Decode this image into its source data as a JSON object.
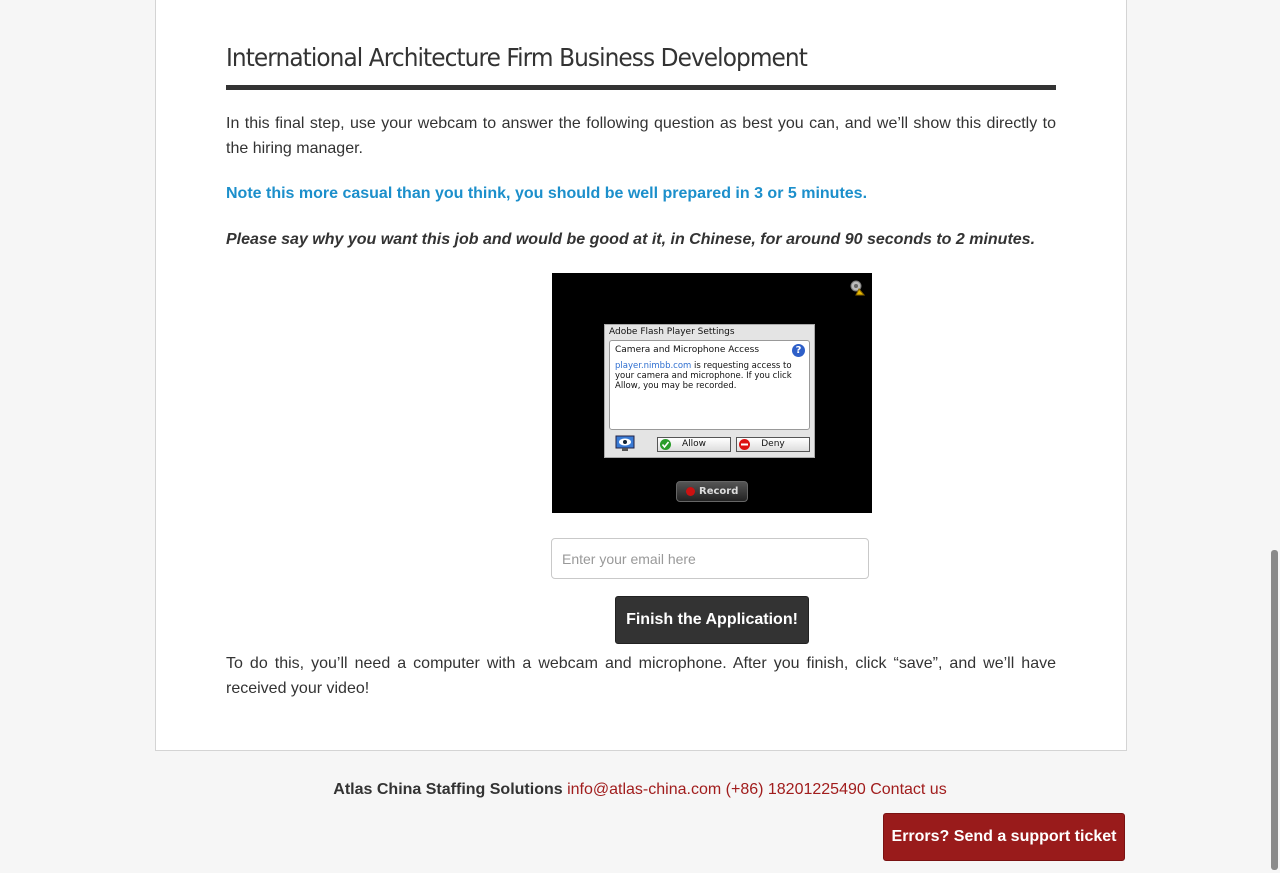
{
  "page": {
    "title": "International Architecture Firm Business Development",
    "intro": "In this final step, use your webcam to answer the following question as best you can, and we’ll show this directly to the hiring manager.",
    "note": "Note this more casual than you think, you should be well prepared in 3 or 5 minutes.",
    "question": "Please say why you want this job and would be good at it, in Chinese, for around 90 seconds to 2 minutes.",
    "outro": "To do this, you’ll need a computer with a webcam and microphone. After you finish, click “save”, and we’ll have received your video!"
  },
  "recorder": {
    "flash_dialog": {
      "title": "Adobe Flash Player Settings",
      "heading": "Camera and Microphone Access",
      "link_text": "player.nimbb.com",
      "body_text": " is requesting access to your camera and microphone. If you click Allow, you may be recorded.",
      "allow_label": "Allow",
      "deny_label": "Deny",
      "help_symbol": "?"
    },
    "record_label": "Record",
    "icons": [
      "settings-icon",
      "help-icon",
      "monitor-icon",
      "check-icon",
      "deny-icon",
      "record-dot-icon"
    ]
  },
  "form": {
    "email_placeholder": "Enter your email here",
    "email_value": "",
    "finish_label": "Finish the Application!"
  },
  "footer": {
    "company": "Atlas China Staffing Solutions",
    "email": "info@atlas-china.com",
    "phone": "(+86) 18201225490",
    "contact_label": "Contact us",
    "support_label": "Errors? Send a support ticket"
  },
  "colors": {
    "note": "#1c8fcb",
    "link": "#a11d1d",
    "support_button": "#991b1b",
    "finish_button": "#333333"
  }
}
